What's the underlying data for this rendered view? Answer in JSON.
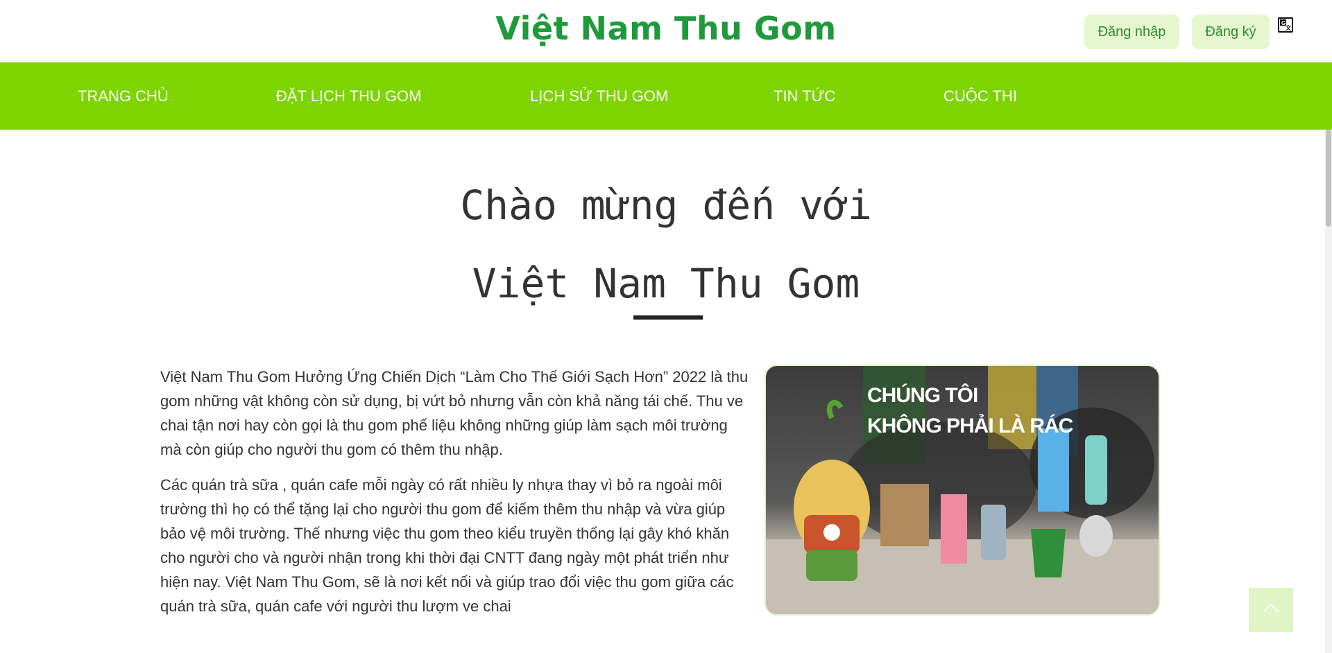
{
  "header": {
    "brand": "Việt Nam Thu Gom",
    "login_label": "Đăng nhập",
    "register_label": "Đăng ký"
  },
  "nav": {
    "items": [
      {
        "label": "TRANG CHỦ"
      },
      {
        "label": "ĐẶT LỊCH THU GOM"
      },
      {
        "label": "LỊCH SỬ THU GOM"
      },
      {
        "label": "TIN TỨC"
      },
      {
        "label": "CUỘC THI"
      }
    ]
  },
  "hero": {
    "line1": "Chào mừng đến với",
    "line2": "Việt Nam Thu Gom"
  },
  "content": {
    "paragraph1": "Việt Nam Thu Gom Hưởng Ứng Chiến Dịch “Làm Cho Thế Giới Sạch Hơn” 2022 là thu gom những vật không còn sử dụng, bị vứt bỏ nhưng vẫn còn khả năng tái chế. Thu ve chai tận nơi hay còn gọi là thu gom phế liệu không những giúp làm sạch môi trường mà còn giúp cho người thu gom có thêm thu nhập.",
    "paragraph2": "Các quán trà sữa , quán cafe mỗi ngày có rất nhiều ly nhựa thay vì bỏ ra ngoài môi trường thì họ có thể tặng lại cho người thu gom để kiếm thêm thu nhập và vừa giúp bảo vệ môi trường. Thế nhưng việc thu gom theo kiểu truyền thống lại gây khó khăn cho người cho và người nhận trong khi thời đại CNTT đang ngày một phát triển như hiện nay. Việt Nam Thu Gom, sẽ là nơi kết nối và giúp trao đổi việc thu gom giữa các quán trà sữa, quán cafe với người thu lượm ve chai"
  },
  "image": {
    "caption_line1": "CHÚNG TÔI",
    "caption_line2": "KHÔNG PHẢI LÀ RÁC"
  },
  "colors": {
    "brand": "#1f9a3a",
    "nav_bg": "#7ed400",
    "button_bg": "#e6f7cf"
  },
  "icons": {
    "translate": "translate-icon",
    "back_to_top": "chevron-up-icon"
  }
}
